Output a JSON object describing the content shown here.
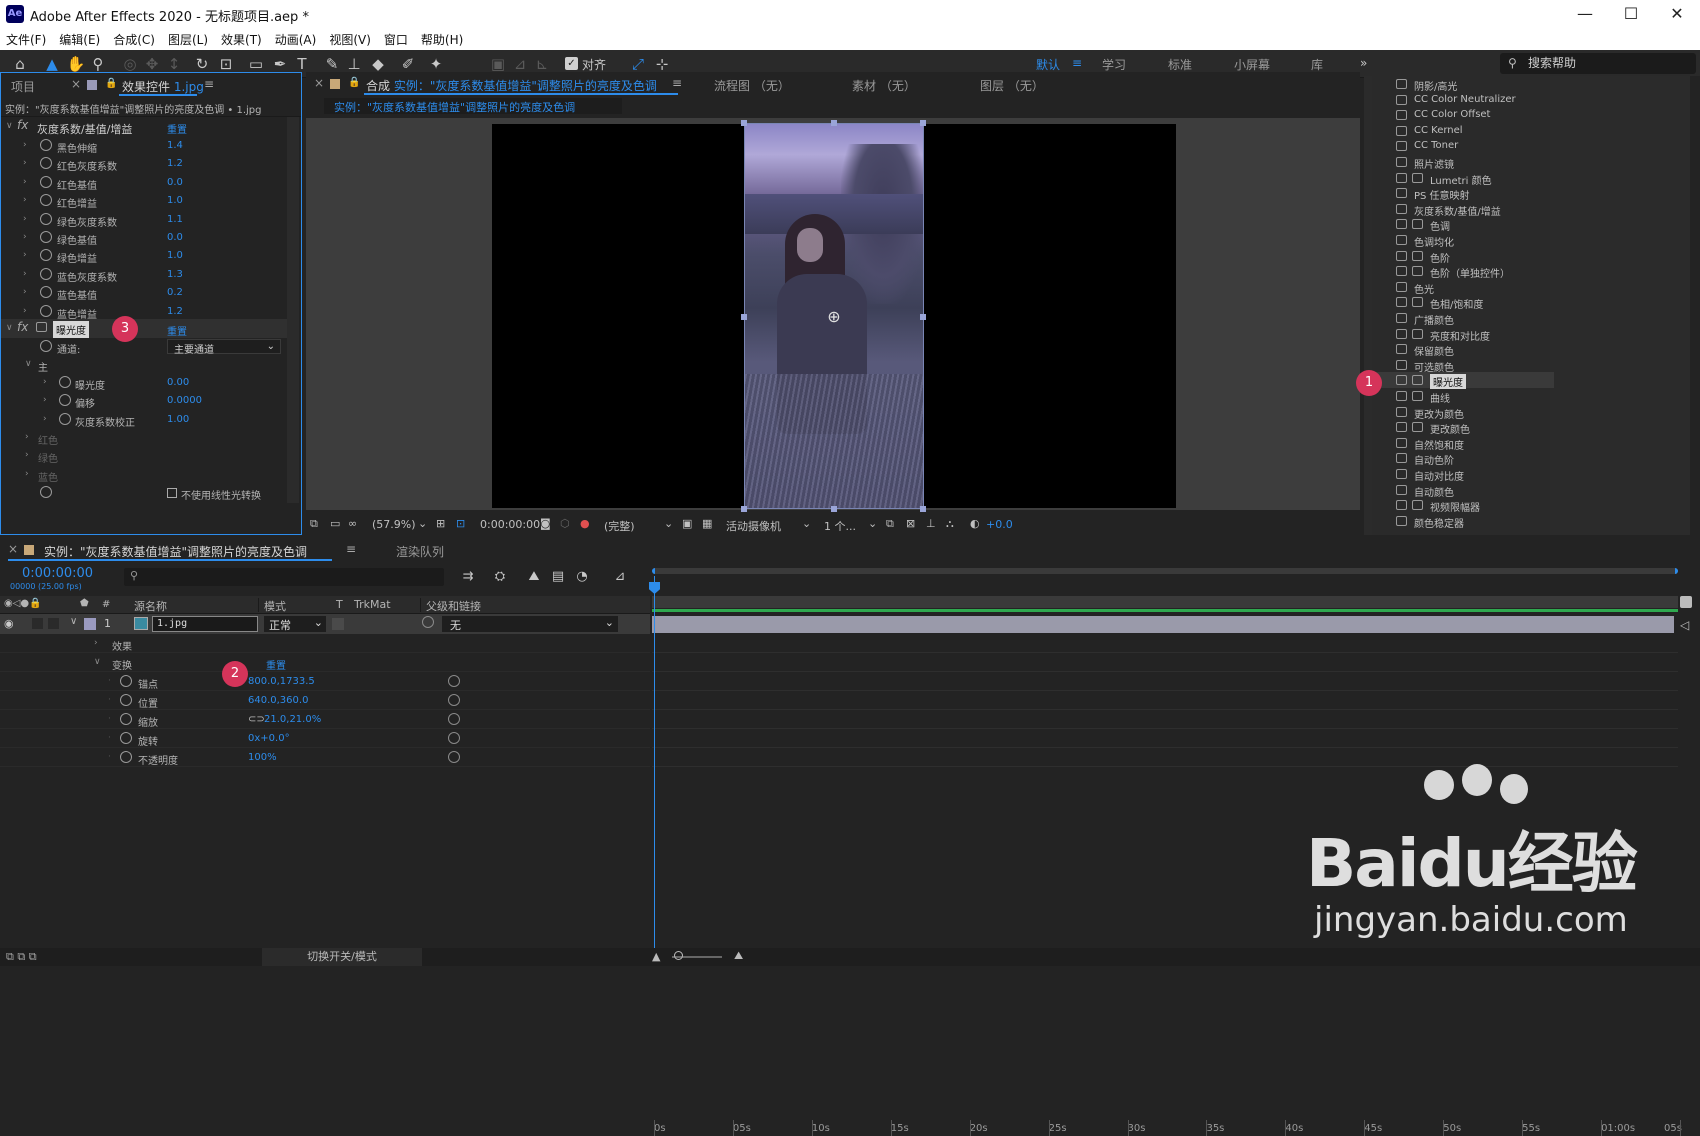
{
  "app": {
    "icon": "Ae",
    "title": "Adobe After Effects 2020 - 无标题项目.aep *"
  },
  "window_controls": {
    "minimize": "—",
    "maximize": "☐",
    "close": "✕"
  },
  "menu": [
    "文件(F)",
    "编辑(E)",
    "合成(C)",
    "图层(L)",
    "效果(T)",
    "动画(A)",
    "视图(V)",
    "窗口",
    "帮助(H)"
  ],
  "toolbar": {
    "snap_label": "对齐"
  },
  "workspaces": {
    "items": [
      "默认",
      "学习",
      "标准",
      "小屏幕",
      "库"
    ],
    "active": "默认",
    "more": "»"
  },
  "help_search": {
    "placeholder": "搜索帮助"
  },
  "left_panel": {
    "tab_project": "项目",
    "tab_effects": "效果控件",
    "tab_effects_file": "1.jpg",
    "subtitle": "实例：\"灰度系数基值增益\"调整照片的亮度及色调 • 1.jpg",
    "effect1": {
      "name": "灰度系数/基值/增益",
      "reset": "重置",
      "props": [
        {
          "name": "黑色伸缩",
          "value": "1.4"
        },
        {
          "name": "红色灰度系数",
          "value": "1.2"
        },
        {
          "name": "红色基值",
          "value": "0.0"
        },
        {
          "name": "红色增益",
          "value": "1.0"
        },
        {
          "name": "绿色灰度系数",
          "value": "1.1"
        },
        {
          "name": "绿色基值",
          "value": "0.0"
        },
        {
          "name": "绿色增益",
          "value": "1.0"
        },
        {
          "name": "蓝色灰度系数",
          "value": "1.3"
        },
        {
          "name": "蓝色基值",
          "value": "0.2"
        },
        {
          "name": "蓝色增益",
          "value": "1.2"
        }
      ]
    },
    "effect2": {
      "name": "曝光度",
      "reset": "重置",
      "channel_label": "通道:",
      "channel_value": "主要通道",
      "main_group": "主",
      "props": [
        {
          "name": "曝光度",
          "value": "0.00"
        },
        {
          "name": "偏移",
          "value": "0.0000"
        },
        {
          "name": "灰度系数校正",
          "value": "1.00"
        }
      ],
      "groups": [
        "红色",
        "绿色",
        "蓝色"
      ],
      "linear_checkbox": "不使用线性光转换"
    }
  },
  "comp_panel": {
    "tab_comp_prefix": "合成",
    "tab_comp_name": "实例：\"灰度系数基值增益\"调整照片的亮度及色调",
    "tab_flowchart": "流程图 （无）",
    "tab_footage": "素材 （无）",
    "tab_layer": "图层 （无）",
    "breadcrumb": "实例：\"灰度系数基值增益\"调整照片的亮度及色调",
    "bottom": {
      "zoom": "(57.9%)",
      "timecode": "0:00:00:00",
      "quality": "(完整)",
      "camera": "活动摄像机",
      "views": "1 个...",
      "exposure": "+0.0"
    }
  },
  "effects_panel": {
    "items": [
      {
        "name": "阴影/高光",
        "badge": false
      },
      {
        "name": "CC Color Neutralizer",
        "badge": false
      },
      {
        "name": "CC Color Offset",
        "badge": false
      },
      {
        "name": "CC Kernel",
        "badge": false
      },
      {
        "name": "CC Toner",
        "badge": false
      },
      {
        "name": "照片滤镜",
        "badge": false
      },
      {
        "name": "Lumetri 颜色",
        "badge": true
      },
      {
        "name": "PS 任意映射",
        "badge": false
      },
      {
        "name": "灰度系数/基值/增益",
        "badge": false
      },
      {
        "name": "色调",
        "badge": true
      },
      {
        "name": "色调均化",
        "badge": false
      },
      {
        "name": "色阶",
        "badge": true
      },
      {
        "name": "色阶（单独控件）",
        "badge": true
      },
      {
        "name": "色光",
        "badge": false
      },
      {
        "name": "色相/饱和度",
        "badge": true
      },
      {
        "name": "广播颜色",
        "badge": false
      },
      {
        "name": "亮度和对比度",
        "badge": true
      },
      {
        "name": "保留颜色",
        "badge": false
      },
      {
        "name": "可选颜色",
        "badge": false
      },
      {
        "name": "曝光度",
        "badge": true,
        "selected": true
      },
      {
        "name": "曲线",
        "badge": true
      },
      {
        "name": "更改为颜色",
        "badge": false
      },
      {
        "name": "更改颜色",
        "badge": true
      },
      {
        "name": "自然饱和度",
        "badge": false
      },
      {
        "name": "自动色阶",
        "badge": false
      },
      {
        "name": "自动对比度",
        "badge": false
      },
      {
        "name": "自动颜色",
        "badge": false
      },
      {
        "name": "视频限幅器",
        "badge": true
      },
      {
        "name": "颜色稳定器",
        "badge": false
      }
    ]
  },
  "timeline": {
    "tab_comp": "实例：\"灰度系数基值增益\"调整照片的亮度及色调",
    "tab_render": "渲染队列",
    "timecode": "0:00:00:00",
    "timecode_sub": "00000 (25.00 fps)",
    "headers": {
      "source": "源名称",
      "mode": "模式",
      "t": "T",
      "trkmat": "TrkMat",
      "parent": "父级和链接"
    },
    "layer": {
      "index": "1",
      "name": "1.jpg",
      "mode": "正常",
      "parent": "无"
    },
    "effects_group": "效果",
    "transform_group": "变换",
    "transform_reset": "重置",
    "transform": [
      {
        "name": "锚点",
        "value": "800.0,1733.5"
      },
      {
        "name": "位置",
        "value": "640.0,360.0"
      },
      {
        "name": "缩放",
        "value": "21.0,21.0%"
      },
      {
        "name": "旋转",
        "value": "0x+0.0°"
      },
      {
        "name": "不透明度",
        "value": "100%"
      }
    ],
    "ruler": [
      "0s",
      "05s",
      "10s",
      "15s",
      "20s",
      "25s",
      "30s",
      "35s",
      "40s",
      "45s",
      "50s",
      "55s",
      "01:00s",
      "05s"
    ],
    "footer_toggle": "切换开关/模式"
  },
  "annotations": [
    "1",
    "2",
    "3"
  ],
  "watermark": {
    "brand": "Baidu经验",
    "url": "jingyan.baidu.com"
  },
  "colors": {
    "accent": "#2d8ceb",
    "badge": "#d5345a",
    "panel": "#232323",
    "bar": "#9a9aaa"
  }
}
